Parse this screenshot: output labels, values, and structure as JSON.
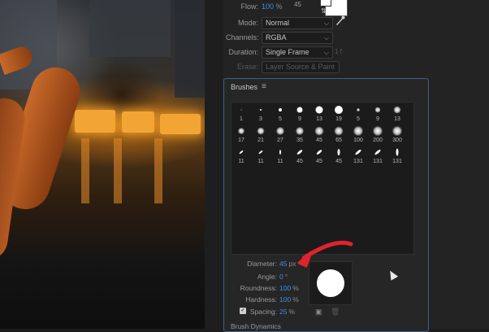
{
  "top_props": {
    "flow": {
      "label": "Flow:",
      "value": "100",
      "unit": "%"
    },
    "top_number": "45",
    "mode": {
      "label": "Mode:",
      "value": "Normal"
    },
    "channels": {
      "label": "Channels:",
      "value": "RGBA"
    },
    "duration": {
      "label": "Duration:",
      "value": "Single Frame",
      "suffix": "1 f"
    },
    "erase": {
      "label": "Erase:",
      "value": "Layer Source & Paint"
    }
  },
  "brushes": {
    "title": "Brushes",
    "menu_icon": "hamburger-menu-icon",
    "tips": [
      {
        "size": "1"
      },
      {
        "size": "3"
      },
      {
        "size": "5"
      },
      {
        "size": "9"
      },
      {
        "size": "13"
      },
      {
        "size": "19"
      },
      {
        "size": "5"
      },
      {
        "size": "9"
      },
      {
        "size": "13"
      },
      {
        "size": "17"
      },
      {
        "size": "21"
      },
      {
        "size": "27"
      },
      {
        "size": "35"
      },
      {
        "size": "45"
      },
      {
        "size": "65"
      },
      {
        "size": "100"
      },
      {
        "size": "200"
      },
      {
        "size": "300"
      },
      {
        "size": "11"
      },
      {
        "size": "11"
      },
      {
        "size": "11"
      },
      {
        "size": "45"
      },
      {
        "size": "45"
      },
      {
        "size": "45"
      },
      {
        "size": "131"
      },
      {
        "size": "131"
      },
      {
        "size": "131"
      }
    ]
  },
  "dynamics": {
    "diameter": {
      "label": "Diameter:",
      "value": "45",
      "unit": "px"
    },
    "angle": {
      "label": "Angle:",
      "value": "0",
      "unit": "°"
    },
    "roundness": {
      "label": "Roundness:",
      "value": "100",
      "unit": "%"
    },
    "hardness": {
      "label": "Hardness:",
      "value": "100",
      "unit": "%"
    },
    "spacing": {
      "label": "Spacing:",
      "value": "25",
      "unit": "%",
      "checked": true
    },
    "section_title": "Brush Dynamics"
  },
  "colors": {
    "accent": "#3f8fe0",
    "annotation_arrow": "#e0232e",
    "panel_border": "#3e5f8c"
  }
}
